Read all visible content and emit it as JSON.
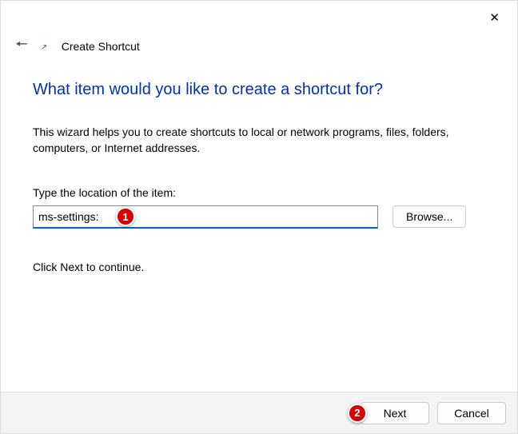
{
  "window": {
    "title": "Create Shortcut"
  },
  "content": {
    "heading": "What item would you like to create a shortcut for?",
    "description": "This wizard helps you to create shortcuts to local or network programs, files, folders, computers, or Internet addresses.",
    "input_label": "Type the location of the item:",
    "input_value": "ms-settings:",
    "browse_label": "Browse...",
    "continue_text": "Click Next to continue."
  },
  "footer": {
    "next_label": "Next",
    "cancel_label": "Cancel"
  },
  "callouts": {
    "c1": "1",
    "c2": "2"
  }
}
